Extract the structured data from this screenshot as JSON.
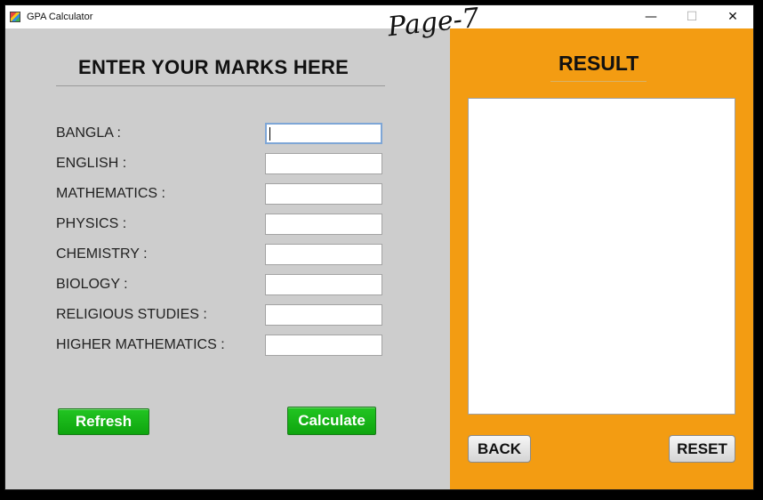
{
  "window": {
    "title": "GPA Calculator",
    "controls": {
      "minimize": "—",
      "maximize": "☐",
      "close": "✕"
    }
  },
  "left": {
    "heading": "ENTER YOUR MARKS HERE",
    "subjects": [
      {
        "label": "BANGLA :",
        "value": ""
      },
      {
        "label": "ENGLISH :",
        "value": ""
      },
      {
        "label": "MATHEMATICS :",
        "value": ""
      },
      {
        "label": "PHYSICS :",
        "value": ""
      },
      {
        "label": "CHEMISTRY :",
        "value": ""
      },
      {
        "label": "BIOLOGY :",
        "value": ""
      },
      {
        "label": "RELIGIOUS STUDIES :",
        "value": ""
      },
      {
        "label": "HIGHER MATHEMATICS :",
        "value": ""
      }
    ],
    "refresh_label": "Refresh",
    "calculate_label": "Calculate"
  },
  "annotation": "Page-7",
  "right": {
    "title": "RESULT",
    "result_text": "",
    "back_label": "BACK",
    "reset_label": "RESET"
  },
  "colors": {
    "left_bg": "#cdcdcd",
    "right_bg": "#f39c12",
    "green_button": "#12b012"
  }
}
